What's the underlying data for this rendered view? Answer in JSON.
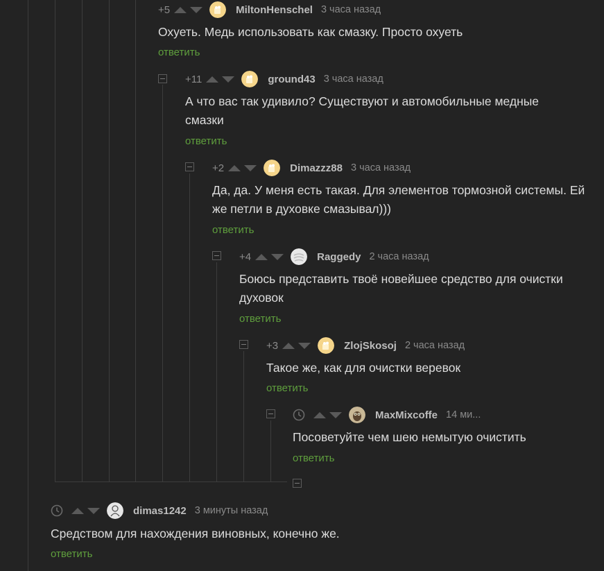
{
  "comments": [
    {
      "rating": "+5",
      "username": "MiltonHenschel",
      "time": "3 часа назад",
      "text": "Охуеть. Медь использовать как смазку. Просто охуеть",
      "reply": "ответить"
    },
    {
      "rating": "+11",
      "username": "ground43",
      "time": "3 часа назад",
      "text": "А что вас так удивило? Существуют и автомобильные медные смазки",
      "reply": "ответить"
    },
    {
      "rating": "+2",
      "username": "Dimazzz88",
      "time": "3 часа назад",
      "text": "Да, да. У меня есть такая. Для элементов тормозной системы. Ей же петли в духовке смазывал)))",
      "reply": "ответить"
    },
    {
      "rating": "+4",
      "username": "Raggedy",
      "time": "2 часа назад",
      "text": "Боюсь представить твоё новейшее средство для очистки духовок",
      "reply": "ответить"
    },
    {
      "rating": "+3",
      "username": "ZlojSkosoj",
      "time": "2 часа назад",
      "text": "Такое же, как для очистки веревок",
      "reply": "ответить"
    },
    {
      "rating": "",
      "username": "MaxMixcoffe",
      "time": "14 ми...",
      "text": "Посоветуйте чем шею немытую очистить",
      "reply": "ответить"
    },
    {
      "rating": "",
      "username": "dimas1242",
      "time": "3 минуты назад",
      "text": "Средством для нахождения виновных, конечно же.",
      "reply": "ответить"
    }
  ],
  "icons": {
    "vote_up": "arrow-up-icon",
    "vote_down": "arrow-down-icon",
    "collapse": "minus-square-icon",
    "pending_rating": "clock-icon"
  },
  "colors": {
    "background": "#232323",
    "reply_link": "#5f9f3d",
    "thread_line": "#3d3d3d"
  }
}
